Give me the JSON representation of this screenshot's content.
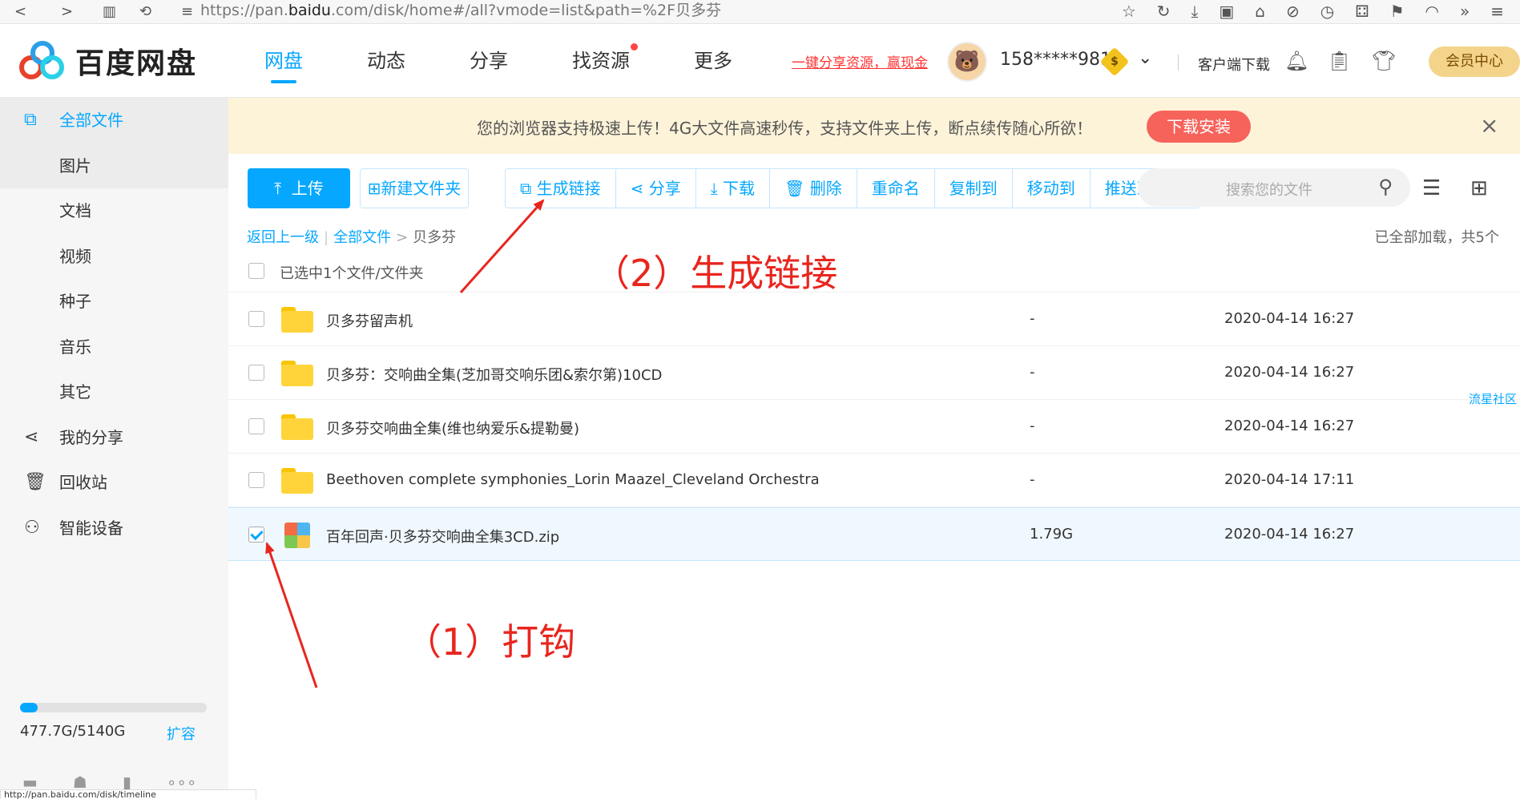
{
  "browser": {
    "url_prefix": "https://pan.",
    "url_host": "baidu",
    "url_suffix": ".com/disk/home#/all?vmode=list&path=%2F贝多芬"
  },
  "header": {
    "logo_text": "百度网盘",
    "tabs": [
      {
        "label": "网盘",
        "active": true
      },
      {
        "label": "动态",
        "active": false
      },
      {
        "label": "分享",
        "active": false
      },
      {
        "label": "找资源",
        "active": false,
        "dot": true
      },
      {
        "label": "更多",
        "active": false
      }
    ],
    "promo": "一键分享资源，赢现金",
    "username": "158*****981",
    "vip_symbol": "$",
    "client_download": "客户端下载",
    "member_center": "会员中心"
  },
  "sidebar": {
    "items": [
      {
        "label": "全部文件",
        "icon": "all-files-icon",
        "glyph": "⧉"
      },
      {
        "label": "图片"
      },
      {
        "label": "文档"
      },
      {
        "label": "视频"
      },
      {
        "label": "种子"
      },
      {
        "label": "音乐"
      },
      {
        "label": "其它"
      },
      {
        "label": "我的分享",
        "icon": "share-icon",
        "glyph": "⋖"
      },
      {
        "label": "回收站",
        "icon": "trash-icon",
        "glyph": "🗑"
      },
      {
        "label": "智能设备",
        "icon": "device-icon",
        "glyph": "⚇"
      }
    ],
    "quota_text": "477.7G/5140G",
    "quota_fraction": 0.093,
    "expand": "扩容",
    "status_url": "http://pan.baidu.com/disk/timeline"
  },
  "banner": {
    "text": "您的浏览器支持极速上传！4G大文件高速秒传，支持文件夹上传，断点续传随心所欲！",
    "button": "下载安装",
    "close": "×"
  },
  "toolbar": {
    "upload": "上传",
    "new_folder": "新建文件夹",
    "group": [
      "生成链接",
      "分享",
      "下载",
      "删除",
      "重命名",
      "复制到",
      "移动到",
      "推送到设备"
    ],
    "search_placeholder": "搜索您的文件"
  },
  "breadcrumb": {
    "back": "返回上一级",
    "root": "全部文件",
    "current": "贝多芬",
    "loaded": "已全部加载，共5个"
  },
  "list": {
    "selected_text": "已选中1个文件/文件夹",
    "rows": [
      {
        "name": "贝多芬留声机",
        "size": "-",
        "date": "2020-04-14 16:27",
        "type": "folder",
        "checked": false
      },
      {
        "name": "贝多芬：交响曲全集(芝加哥交响乐团&索尔第)10CD",
        "size": "-",
        "date": "2020-04-14 16:27",
        "type": "folder",
        "checked": false
      },
      {
        "name": "贝多芬交响曲全集(维也纳爱乐&提勒曼)",
        "size": "-",
        "date": "2020-04-14 16:27",
        "type": "folder",
        "checked": false
      },
      {
        "name": "Beethoven complete symphonies_Lorin Maazel_Cleveland Orchestra",
        "size": "-",
        "date": "2020-04-14 17:11",
        "type": "folder",
        "checked": false
      },
      {
        "name": "百年回声·贝多芬交响曲全集3CD.zip",
        "size": "1.79G",
        "date": "2020-04-14 16:27",
        "type": "zip",
        "checked": true
      }
    ],
    "side_tag": "流星社区"
  },
  "annotations": {
    "step1": "（1）打钩",
    "step2": "（2）生成链接"
  },
  "colors": {
    "accent": "#06a7ff",
    "annotation": "#e8261e",
    "banner_bg": "#fdf3d9",
    "banner_button": "#f6635b"
  }
}
